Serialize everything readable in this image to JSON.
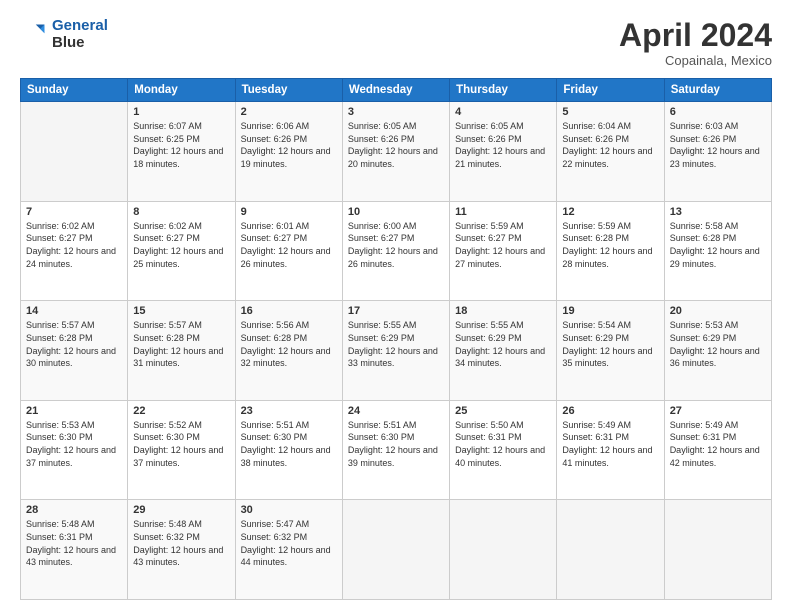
{
  "header": {
    "logo_line1": "General",
    "logo_line2": "Blue",
    "month": "April 2024",
    "location": "Copainala, Mexico"
  },
  "days_of_week": [
    "Sunday",
    "Monday",
    "Tuesday",
    "Wednesday",
    "Thursday",
    "Friday",
    "Saturday"
  ],
  "weeks": [
    [
      {
        "num": "",
        "sunrise": "",
        "sunset": "",
        "daylight": ""
      },
      {
        "num": "1",
        "sunrise": "Sunrise: 6:07 AM",
        "sunset": "Sunset: 6:25 PM",
        "daylight": "Daylight: 12 hours and 18 minutes."
      },
      {
        "num": "2",
        "sunrise": "Sunrise: 6:06 AM",
        "sunset": "Sunset: 6:26 PM",
        "daylight": "Daylight: 12 hours and 19 minutes."
      },
      {
        "num": "3",
        "sunrise": "Sunrise: 6:05 AM",
        "sunset": "Sunset: 6:26 PM",
        "daylight": "Daylight: 12 hours and 20 minutes."
      },
      {
        "num": "4",
        "sunrise": "Sunrise: 6:05 AM",
        "sunset": "Sunset: 6:26 PM",
        "daylight": "Daylight: 12 hours and 21 minutes."
      },
      {
        "num": "5",
        "sunrise": "Sunrise: 6:04 AM",
        "sunset": "Sunset: 6:26 PM",
        "daylight": "Daylight: 12 hours and 22 minutes."
      },
      {
        "num": "6",
        "sunrise": "Sunrise: 6:03 AM",
        "sunset": "Sunset: 6:26 PM",
        "daylight": "Daylight: 12 hours and 23 minutes."
      }
    ],
    [
      {
        "num": "7",
        "sunrise": "Sunrise: 6:02 AM",
        "sunset": "Sunset: 6:27 PM",
        "daylight": "Daylight: 12 hours and 24 minutes."
      },
      {
        "num": "8",
        "sunrise": "Sunrise: 6:02 AM",
        "sunset": "Sunset: 6:27 PM",
        "daylight": "Daylight: 12 hours and 25 minutes."
      },
      {
        "num": "9",
        "sunrise": "Sunrise: 6:01 AM",
        "sunset": "Sunset: 6:27 PM",
        "daylight": "Daylight: 12 hours and 26 minutes."
      },
      {
        "num": "10",
        "sunrise": "Sunrise: 6:00 AM",
        "sunset": "Sunset: 6:27 PM",
        "daylight": "Daylight: 12 hours and 26 minutes."
      },
      {
        "num": "11",
        "sunrise": "Sunrise: 5:59 AM",
        "sunset": "Sunset: 6:27 PM",
        "daylight": "Daylight: 12 hours and 27 minutes."
      },
      {
        "num": "12",
        "sunrise": "Sunrise: 5:59 AM",
        "sunset": "Sunset: 6:28 PM",
        "daylight": "Daylight: 12 hours and 28 minutes."
      },
      {
        "num": "13",
        "sunrise": "Sunrise: 5:58 AM",
        "sunset": "Sunset: 6:28 PM",
        "daylight": "Daylight: 12 hours and 29 minutes."
      }
    ],
    [
      {
        "num": "14",
        "sunrise": "Sunrise: 5:57 AM",
        "sunset": "Sunset: 6:28 PM",
        "daylight": "Daylight: 12 hours and 30 minutes."
      },
      {
        "num": "15",
        "sunrise": "Sunrise: 5:57 AM",
        "sunset": "Sunset: 6:28 PM",
        "daylight": "Daylight: 12 hours and 31 minutes."
      },
      {
        "num": "16",
        "sunrise": "Sunrise: 5:56 AM",
        "sunset": "Sunset: 6:28 PM",
        "daylight": "Daylight: 12 hours and 32 minutes."
      },
      {
        "num": "17",
        "sunrise": "Sunrise: 5:55 AM",
        "sunset": "Sunset: 6:29 PM",
        "daylight": "Daylight: 12 hours and 33 minutes."
      },
      {
        "num": "18",
        "sunrise": "Sunrise: 5:55 AM",
        "sunset": "Sunset: 6:29 PM",
        "daylight": "Daylight: 12 hours and 34 minutes."
      },
      {
        "num": "19",
        "sunrise": "Sunrise: 5:54 AM",
        "sunset": "Sunset: 6:29 PM",
        "daylight": "Daylight: 12 hours and 35 minutes."
      },
      {
        "num": "20",
        "sunrise": "Sunrise: 5:53 AM",
        "sunset": "Sunset: 6:29 PM",
        "daylight": "Daylight: 12 hours and 36 minutes."
      }
    ],
    [
      {
        "num": "21",
        "sunrise": "Sunrise: 5:53 AM",
        "sunset": "Sunset: 6:30 PM",
        "daylight": "Daylight: 12 hours and 37 minutes."
      },
      {
        "num": "22",
        "sunrise": "Sunrise: 5:52 AM",
        "sunset": "Sunset: 6:30 PM",
        "daylight": "Daylight: 12 hours and 37 minutes."
      },
      {
        "num": "23",
        "sunrise": "Sunrise: 5:51 AM",
        "sunset": "Sunset: 6:30 PM",
        "daylight": "Daylight: 12 hours and 38 minutes."
      },
      {
        "num": "24",
        "sunrise": "Sunrise: 5:51 AM",
        "sunset": "Sunset: 6:30 PM",
        "daylight": "Daylight: 12 hours and 39 minutes."
      },
      {
        "num": "25",
        "sunrise": "Sunrise: 5:50 AM",
        "sunset": "Sunset: 6:31 PM",
        "daylight": "Daylight: 12 hours and 40 minutes."
      },
      {
        "num": "26",
        "sunrise": "Sunrise: 5:49 AM",
        "sunset": "Sunset: 6:31 PM",
        "daylight": "Daylight: 12 hours and 41 minutes."
      },
      {
        "num": "27",
        "sunrise": "Sunrise: 5:49 AM",
        "sunset": "Sunset: 6:31 PM",
        "daylight": "Daylight: 12 hours and 42 minutes."
      }
    ],
    [
      {
        "num": "28",
        "sunrise": "Sunrise: 5:48 AM",
        "sunset": "Sunset: 6:31 PM",
        "daylight": "Daylight: 12 hours and 43 minutes."
      },
      {
        "num": "29",
        "sunrise": "Sunrise: 5:48 AM",
        "sunset": "Sunset: 6:32 PM",
        "daylight": "Daylight: 12 hours and 43 minutes."
      },
      {
        "num": "30",
        "sunrise": "Sunrise: 5:47 AM",
        "sunset": "Sunset: 6:32 PM",
        "daylight": "Daylight: 12 hours and 44 minutes."
      },
      {
        "num": "",
        "sunrise": "",
        "sunset": "",
        "daylight": ""
      },
      {
        "num": "",
        "sunrise": "",
        "sunset": "",
        "daylight": ""
      },
      {
        "num": "",
        "sunrise": "",
        "sunset": "",
        "daylight": ""
      },
      {
        "num": "",
        "sunrise": "",
        "sunset": "",
        "daylight": ""
      }
    ]
  ]
}
